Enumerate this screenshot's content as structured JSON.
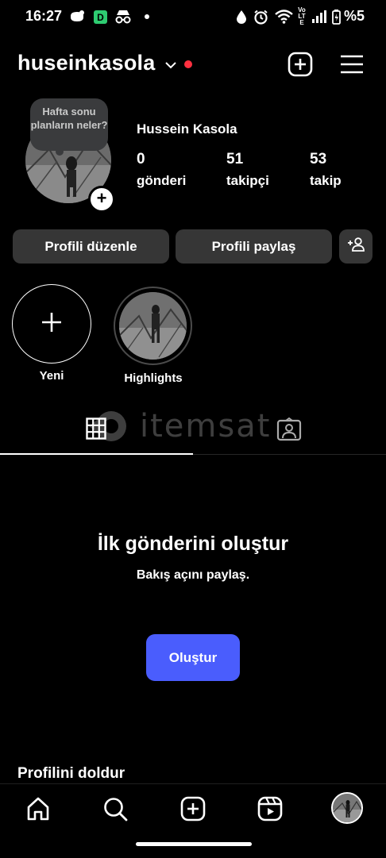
{
  "status_bar": {
    "time": "16:27",
    "battery": "%5",
    "icons": [
      "notification-icon",
      "app-d-icon",
      "incognito-icon",
      "dot-icon",
      "data-saver-icon",
      "alarm-icon",
      "wifi-icon",
      "volte-icon",
      "signal-icon",
      "battery-icon"
    ],
    "volte": "Vo LTE"
  },
  "header": {
    "username": "huseinkasola",
    "live_dot_color": "#ff3040"
  },
  "profile": {
    "note": "Hafta sonu planların neler?",
    "full_name": "Hussein Kasola",
    "stats": [
      {
        "value": "0",
        "label": "gönderi"
      },
      {
        "value": "51",
        "label": "takipçi"
      },
      {
        "value": "53",
        "label": "takip"
      }
    ]
  },
  "buttons": {
    "edit_profile": "Profili düzenle",
    "share_profile": "Profili paylaş"
  },
  "highlights": [
    {
      "label": "Yeni"
    },
    {
      "label": "Highlights"
    }
  ],
  "watermark": "itemsat",
  "empty_state": {
    "title": "İlk gönderini oluştur",
    "subtitle": "Bakış açını paylaş.",
    "button": "Oluştur",
    "button_color": "#4a5dfd"
  },
  "section": {
    "complete_profile": "Profilini doldur"
  },
  "bottom_nav": [
    "home-icon",
    "search-icon",
    "create-icon",
    "reels-icon",
    "profile-avatar"
  ]
}
